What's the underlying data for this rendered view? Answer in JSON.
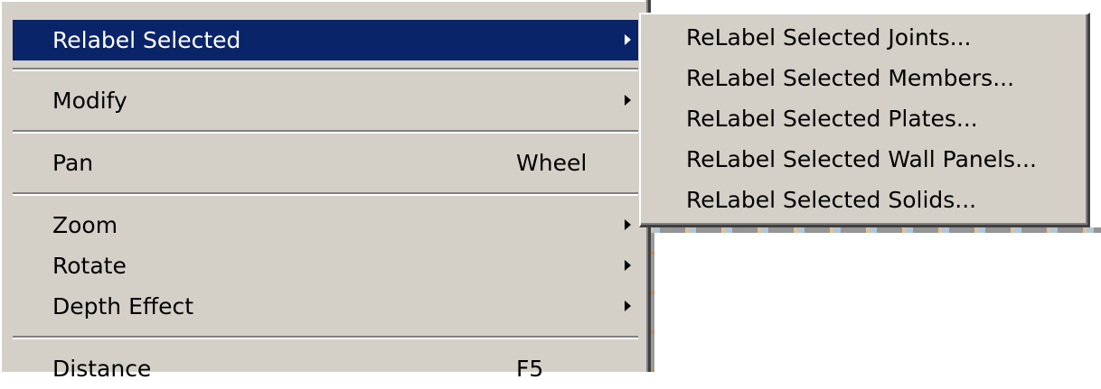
{
  "menu": {
    "items": [
      {
        "label": "Relabel Selected",
        "accel": "",
        "submenu": true,
        "selected": true
      },
      {
        "label": "Modify",
        "accel": "",
        "submenu": true,
        "selected": false
      },
      {
        "label": "Pan",
        "accel": "Wheel",
        "submenu": false,
        "selected": false
      },
      {
        "label": "Zoom",
        "accel": "",
        "submenu": true,
        "selected": false
      },
      {
        "label": "Rotate",
        "accel": "",
        "submenu": true,
        "selected": false
      },
      {
        "label": "Depth Effect",
        "accel": "",
        "submenu": true,
        "selected": false
      },
      {
        "label": "Distance",
        "accel": "F5",
        "submenu": false,
        "selected": false
      }
    ]
  },
  "submenu": {
    "items": [
      {
        "label": "ReLabel Selected Joints..."
      },
      {
        "label": "ReLabel Selected Members..."
      },
      {
        "label": "ReLabel Selected Plates..."
      },
      {
        "label": "ReLabel Selected Wall Panels..."
      },
      {
        "label": "ReLabel Selected Solids..."
      }
    ]
  },
  "colors": {
    "menu_bg": "#d4d0c8",
    "highlight": "#0a246a",
    "highlight_text": "#ffffff"
  }
}
